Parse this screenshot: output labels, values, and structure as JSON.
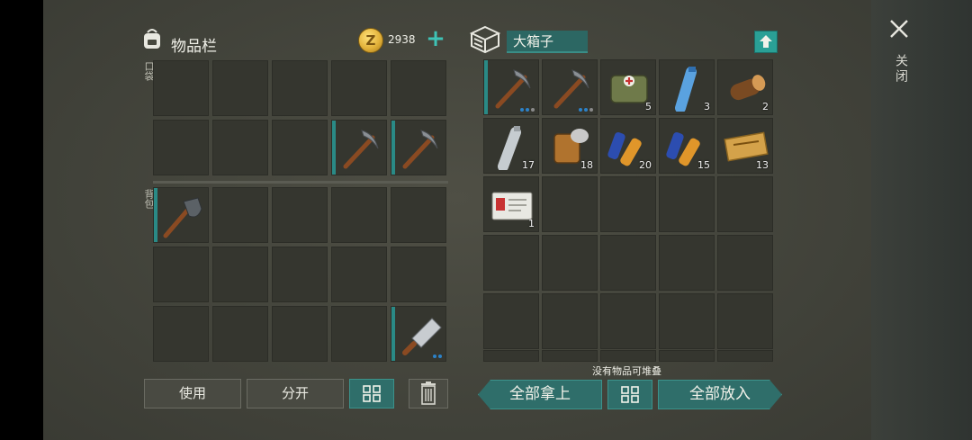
{
  "inventory": {
    "title": "物品栏",
    "coins": {
      "value": "2938",
      "icon": "z-coin-icon",
      "add_icon": "plus-icon"
    },
    "pocket_label": "口袋",
    "backpack_label": "背包",
    "pocket_slots": [
      {
        "item": null
      },
      {
        "item": null
      },
      {
        "item": null
      },
      {
        "item": null
      },
      {
        "item": null
      },
      {
        "item": null
      },
      {
        "item": null
      },
      {
        "item": null
      },
      {
        "item": "pickaxe-icon",
        "marked": true
      },
      {
        "item": "pickaxe-icon",
        "marked": true
      }
    ],
    "backpack_slots": [
      {
        "item": "shovel-icon",
        "marked": true
      },
      {
        "item": null
      },
      {
        "item": null
      },
      {
        "item": null
      },
      {
        "item": null
      },
      {
        "item": null
      },
      {
        "item": null
      },
      {
        "item": null
      },
      {
        "item": null
      },
      {
        "item": null
      },
      {
        "item": null
      },
      {
        "item": null
      },
      {
        "item": null
      },
      {
        "item": null
      },
      {
        "item": "cleaver-icon",
        "marked": true,
        "durability": [
          1,
          1
        ]
      }
    ]
  },
  "container": {
    "name": "大箱子",
    "icon": "crate-icon",
    "upload_icon": "upload-arrow-icon",
    "slots": [
      {
        "item": "pickaxe-icon",
        "marked": true,
        "durability": [
          1,
          1,
          0
        ]
      },
      {
        "item": "pickaxe-icon",
        "durability": [
          1,
          1,
          0
        ]
      },
      {
        "item": "first-aid-bag-icon",
        "count": "5"
      },
      {
        "item": "water-bottle-icon",
        "count": "3"
      },
      {
        "item": "log-icon",
        "count": "2"
      },
      {
        "item": "empty-bottle-icon",
        "count": "17"
      },
      {
        "item": "tin-can-icon",
        "count": "18"
      },
      {
        "item": "battery-icon",
        "count": "20"
      },
      {
        "item": "battery-icon",
        "count": "15"
      },
      {
        "item": "coupon-icon",
        "count": "13"
      },
      {
        "item": "id-card-icon",
        "count": "1"
      }
    ],
    "status_text": "没有物品可堆叠"
  },
  "buttons": {
    "use": "使用",
    "split": "分开",
    "take_all": "全部拿上",
    "put_all": "全部放入",
    "sort_icon": "grid-sort-icon",
    "trash_icon": "trash-icon"
  },
  "close": {
    "label": "关闭",
    "icon": "close-icon"
  },
  "colors": {
    "accent": "#2f6e6a",
    "accent_light": "#3ec3b6",
    "slot": "#35362f",
    "background": "#48493f"
  }
}
